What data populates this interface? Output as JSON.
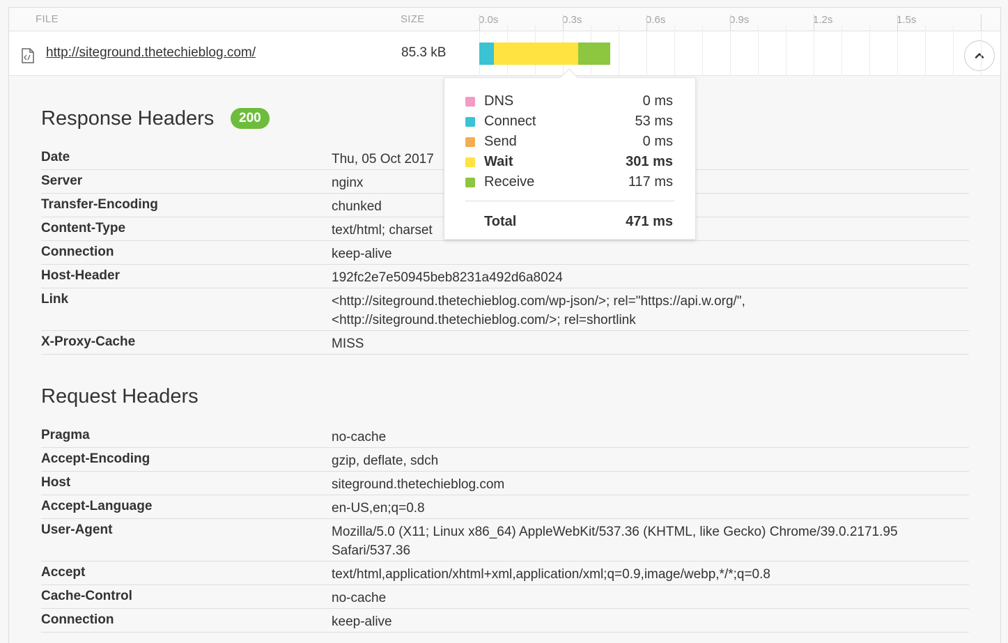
{
  "columns": {
    "file": "FILE",
    "size": "SIZE"
  },
  "timeline": {
    "ticks": [
      "0.0s",
      "0.3s",
      "0.6s",
      "0.9s",
      "1.2s",
      "1.5s"
    ],
    "max_seconds": 1.8
  },
  "file": {
    "url": "http://siteground.thetechieblog.com/",
    "size": "85.3 kB",
    "timings_ms": {
      "dns": 0,
      "connect": 53,
      "send": 0,
      "wait": 301,
      "receive": 117
    },
    "start_ms": 0
  },
  "colors": {
    "dns": "#f29bc4",
    "connect": "#3bc3d3",
    "send": "#f5ad52",
    "wait": "#ffe341",
    "receive": "#8dc63f",
    "badge": "#6ebc3c"
  },
  "tooltip": {
    "rows": [
      {
        "key": "dns",
        "label": "DNS",
        "value": "0 ms",
        "bold": false
      },
      {
        "key": "connect",
        "label": "Connect",
        "value": "53 ms",
        "bold": false
      },
      {
        "key": "send",
        "label": "Send",
        "value": "0 ms",
        "bold": false
      },
      {
        "key": "wait",
        "label": "Wait",
        "value": "301 ms",
        "bold": true
      },
      {
        "key": "receive",
        "label": "Receive",
        "value": "117 ms",
        "bold": false
      }
    ],
    "total_label": "Total",
    "total_value": "471 ms"
  },
  "response": {
    "title": "Response Headers",
    "status": "200",
    "headers": [
      {
        "key": "Date",
        "value": "Thu, 05 Oct 2017"
      },
      {
        "key": "Server",
        "value": "nginx"
      },
      {
        "key": "Transfer-Encoding",
        "value": "chunked"
      },
      {
        "key": "Content-Type",
        "value": "text/html; charset"
      },
      {
        "key": "Connection",
        "value": "keep-alive"
      },
      {
        "key": "Host-Header",
        "value": "192fc2e7e50945beb8231a492d6a8024"
      },
      {
        "key": "Link",
        "value": "<http://siteground.thetechieblog.com/wp-json/>; rel=\"https://api.w.org/\", <http://siteground.thetechieblog.com/>; rel=shortlink"
      },
      {
        "key": "X-Proxy-Cache",
        "value": "MISS"
      }
    ]
  },
  "request": {
    "title": "Request Headers",
    "headers": [
      {
        "key": "Pragma",
        "value": "no-cache"
      },
      {
        "key": "Accept-Encoding",
        "value": "gzip, deflate, sdch"
      },
      {
        "key": "Host",
        "value": "siteground.thetechieblog.com"
      },
      {
        "key": "Accept-Language",
        "value": "en-US,en;q=0.8"
      },
      {
        "key": "User-Agent",
        "value": "Mozilla/5.0 (X11; Linux x86_64) AppleWebKit/537.36 (KHTML, like Gecko) Chrome/39.0.2171.95 Safari/537.36"
      },
      {
        "key": "Accept",
        "value": "text/html,application/xhtml+xml,application/xml;q=0.9,image/webp,*/*;q=0.8"
      },
      {
        "key": "Cache-Control",
        "value": "no-cache"
      },
      {
        "key": "Connection",
        "value": "keep-alive"
      }
    ]
  }
}
